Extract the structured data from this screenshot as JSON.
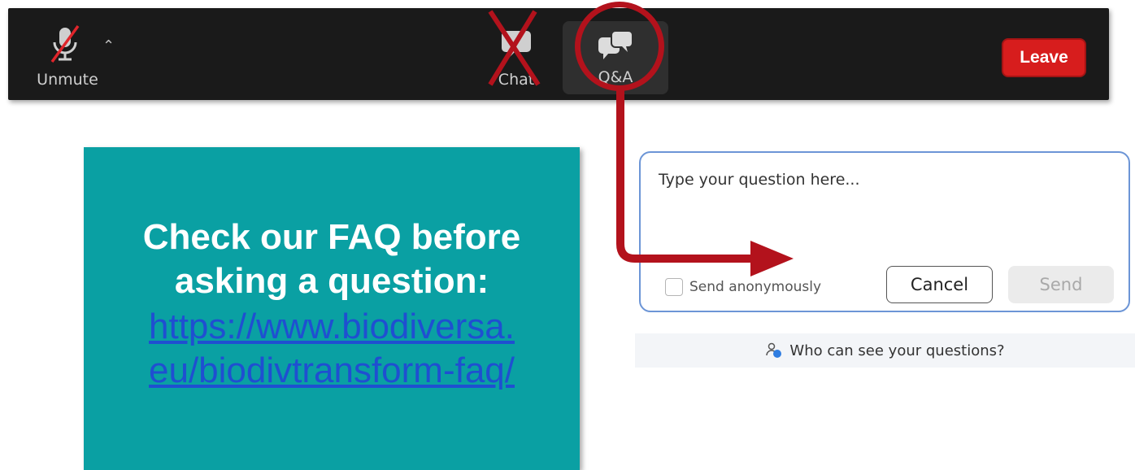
{
  "toolbar": {
    "unmute_label": "Unmute",
    "unmute_icon": "mic-muted-icon",
    "caret_icon": "caret-up-icon",
    "chat_label": "Chat",
    "chat_icon": "chat-bubble-icon",
    "qa_label": "Q&A",
    "qa_icon": "qa-bubbles-icon",
    "leave_label": "Leave"
  },
  "card": {
    "heading_line1": "Check our FAQ before",
    "heading_line2": "asking a question:",
    "link_line1": "https://www.biodiversa.",
    "link_line2": "eu/biodivtransform-faq/"
  },
  "qa_panel": {
    "placeholder": "Type your question here...",
    "anonymous_label": "Send anonymously",
    "cancel_label": "Cancel",
    "send_label": "Send",
    "who_can_see": "Who can see your questions?"
  },
  "colors": {
    "toolbar_bg": "#1a1a1a",
    "leave_red": "#d71d1d",
    "annotation_red": "#b3121c",
    "card_teal": "#0aa0a3",
    "link_blue": "#1f4fd1",
    "panel_border": "#6c95d6"
  }
}
